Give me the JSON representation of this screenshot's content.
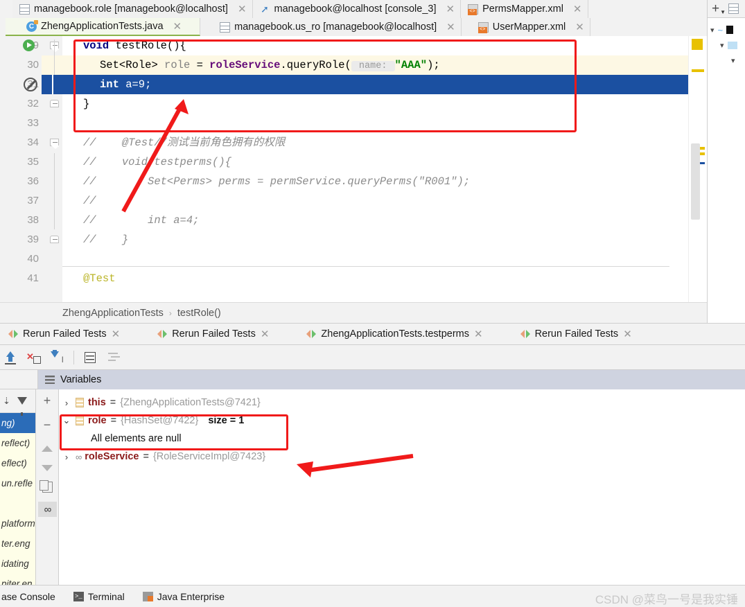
{
  "editor_tabs_row1": [
    {
      "label": "managebook.role [managebook@localhost]",
      "icon": "database-table-icon"
    },
    {
      "label": "managebook@localhost [console_3]",
      "icon": "console-icon"
    },
    {
      "label": "PermsMapper.xml",
      "icon": "xml-file-icon"
    }
  ],
  "editor_tabs_row2": [
    {
      "label": "ZhengApplicationTests.java",
      "icon": "java-class-icon",
      "active": true
    },
    {
      "label": "managebook.us_ro [managebook@localhost]",
      "icon": "database-table-icon"
    },
    {
      "label": "UserMapper.xml",
      "icon": "xml-file-icon"
    }
  ],
  "right_panel": {
    "add_label": "+",
    "tree_rows": [
      "",
      "",
      ""
    ]
  },
  "code_lines": [
    {
      "num": "29",
      "indent": 30,
      "gutter": "run-gradle-icon",
      "fold": "collapse-triangle",
      "tokens": [
        {
          "t": "void",
          "c": "kw"
        },
        {
          "t": " ",
          "c": "pln"
        },
        {
          "t": "testRole",
          "c": "pln"
        },
        {
          "t": "(){",
          "c": "pln"
        }
      ]
    },
    {
      "num": "30",
      "indent": 54,
      "highlight": "current-line",
      "tokens": [
        {
          "t": "Set",
          "c": "tp"
        },
        {
          "t": "<",
          "c": "pln"
        },
        {
          "t": "Role",
          "c": "tp"
        },
        {
          "t": "> ",
          "c": "pln"
        },
        {
          "t": "role",
          "c": "gr"
        },
        {
          "t": " = ",
          "c": "pln"
        },
        {
          "t": "roleService",
          "c": "fld"
        },
        {
          "t": ".queryRole(",
          "c": "pln"
        },
        {
          "t": " name: ",
          "c": "hint"
        },
        {
          "t": "\"AAA\"",
          "c": "str"
        },
        {
          "t": ");",
          "c": "pln"
        }
      ]
    },
    {
      "num": "31",
      "indent": 54,
      "gutter": "breakpoint-muted-icon",
      "selected": true,
      "tokens": [
        {
          "t": "int",
          "c": "kw"
        },
        {
          "t": " a=9;",
          "c": "pln"
        }
      ]
    },
    {
      "num": "32",
      "indent": 30,
      "fold": "collapse-box",
      "tokens": [
        {
          "t": "}",
          "c": "pln"
        }
      ]
    },
    {
      "num": "33",
      "indent": 30,
      "tokens": []
    },
    {
      "num": "34",
      "indent": 30,
      "fold": "collapse-triangle",
      "tokens": [
        {
          "t": "//    ",
          "c": "cmt"
        },
        {
          "t": "@Test//测试当前角色拥有的权限",
          "c": "cmt"
        }
      ]
    },
    {
      "num": "35",
      "indent": 30,
      "tokens": [
        {
          "t": "//    ",
          "c": "cmt"
        },
        {
          "t": "void testperms(){",
          "c": "cmt"
        }
      ]
    },
    {
      "num": "36",
      "indent": 30,
      "tokens": [
        {
          "t": "//        ",
          "c": "cmt"
        },
        {
          "t": "Set<Perms> perms = permService.queryPerms(\"R001\");",
          "c": "cmt"
        }
      ]
    },
    {
      "num": "37",
      "indent": 30,
      "tokens": [
        {
          "t": "//",
          "c": "cmt"
        }
      ]
    },
    {
      "num": "38",
      "indent": 30,
      "tokens": [
        {
          "t": "//        ",
          "c": "cmt"
        },
        {
          "t": "int a=4;",
          "c": "cmt"
        }
      ]
    },
    {
      "num": "39",
      "indent": 30,
      "fold": "collapse-box",
      "tokens": [
        {
          "t": "//    ",
          "c": "cmt"
        },
        {
          "t": "}",
          "c": "cmt"
        }
      ]
    },
    {
      "num": "40",
      "indent": 30,
      "tokens": []
    },
    {
      "num": "41",
      "indent": 30,
      "tokens": [
        {
          "t": "@Test",
          "c": "ann"
        }
      ]
    }
  ],
  "breadcrumb": {
    "class": "ZhengApplicationTests",
    "separator": "›",
    "method": "testRole()"
  },
  "run_tabs": [
    {
      "label": "Rerun Failed Tests"
    },
    {
      "label": "Rerun Failed Tests"
    },
    {
      "label": "ZhengApplicationTests.testperms"
    },
    {
      "label": "Rerun Failed Tests"
    }
  ],
  "debug_toolbar": [
    {
      "name": "step-out-icon"
    },
    {
      "name": "force-step-into-icon"
    },
    {
      "name": "step-into-icon"
    },
    {
      "name": "evaluate-expression-icon"
    },
    {
      "name": "sort-values-icon"
    }
  ],
  "variables_panel": {
    "title": "Variables",
    "rows": [
      {
        "chevron": "›",
        "name": "this",
        "eq": "=",
        "value": "{ZhengApplicationTests@7421}",
        "size": "",
        "icon": "object-field-icon"
      },
      {
        "chevron": "⌄",
        "name": "role",
        "eq": "=",
        "value": "{HashSet@7422}",
        "size": "size = 1",
        "icon": "object-field-icon",
        "highlighted": true
      },
      {
        "chevron": "›",
        "name": "roleService",
        "eq": "=",
        "value": "{RoleServiceImpl@7423}",
        "size": "",
        "icon": "interface-field-icon"
      }
    ],
    "null_note": "All elements are null"
  },
  "frames_panel": {
    "rows": [
      {
        "text": "ng)",
        "selected": true
      },
      {
        "text": "reflect)"
      },
      {
        "text": "eflect)"
      },
      {
        "text": "un.refle"
      },
      {
        "text": ""
      },
      {
        "text": "platform"
      },
      {
        "text": "ter.eng"
      },
      {
        "text": "idating"
      },
      {
        "text": "piter.en"
      }
    ]
  },
  "variables_tools": [
    "+",
    "−",
    "up-arrow",
    "down-arrow",
    "copy-icon",
    "watches-icon"
  ],
  "status_bar": {
    "items": [
      {
        "label": "ase Console",
        "icon": ""
      },
      {
        "label": "Terminal",
        "icon": "terminal-icon"
      },
      {
        "label": "Java Enterprise",
        "icon": "java-enterprise-icon"
      }
    ],
    "watermark": "CSDN @菜鸟一号是我实锤"
  },
  "colors": {
    "annotation_red": "#f01a1a",
    "selection_blue": "#1b50a1",
    "current_line": "#fdf8e4",
    "keyword": "#000080",
    "string": "#008000",
    "comment": "#8c8c8c",
    "field": "#660e7a",
    "annotation_token": "#bbb529",
    "vars_header": "#cfd3e0"
  }
}
